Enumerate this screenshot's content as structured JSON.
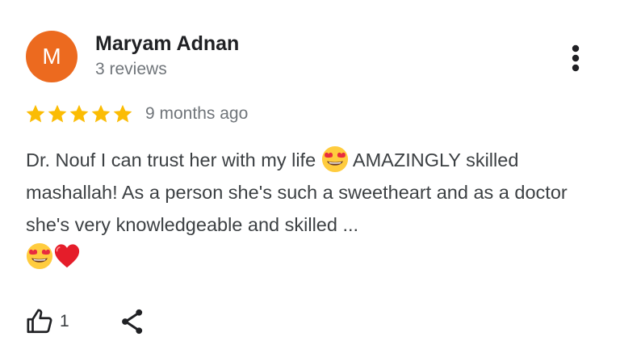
{
  "review": {
    "author": {
      "initial": "M",
      "name": "Maryam Adnan",
      "review_count": "3 reviews",
      "avatar_color": "#ec6a1f"
    },
    "rating": {
      "stars": 5,
      "max_stars": 5,
      "star_color": "#fbbc04"
    },
    "time_ago": "9 months ago",
    "text_segments": [
      "Dr. Nouf I can trust her with my life ",
      " AMAZINGLY skilled mashallah! As a person she's such a sweetheart and as a doctor she's very knowledgeable and skilled ..."
    ],
    "emojis": [
      "heart-eyes-emoji",
      "heart-eyes-emoji",
      "red-heart-emoji"
    ],
    "likes": "1"
  },
  "icons": {
    "more": "more-vertical-icon",
    "like": "thumbs-up-icon",
    "share": "share-icon"
  }
}
